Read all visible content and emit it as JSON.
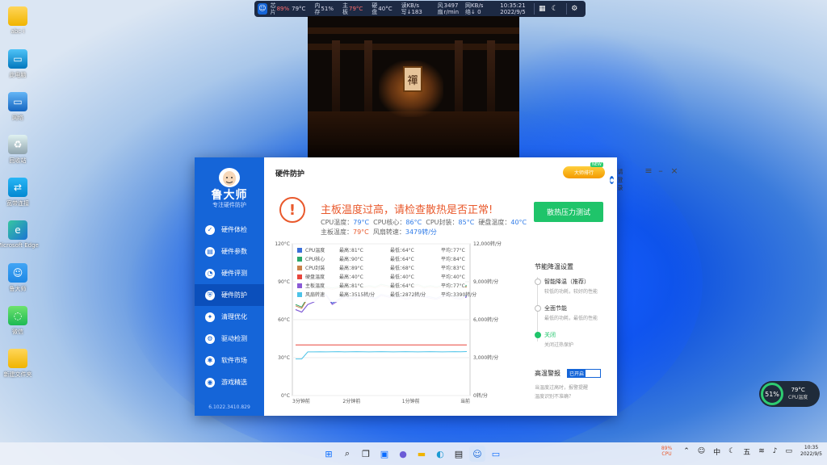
{
  "desktop": {
    "icons": [
      {
        "label": "abc-i",
        "icon": "folder-icon"
      },
      {
        "label": "此电脑",
        "icon": "computer-icon"
      },
      {
        "label": "网络",
        "icon": "network-icon"
      },
      {
        "label": "回收站",
        "icon": "recycle-bin-icon"
      },
      {
        "label": "宽带连接",
        "icon": "broadband-icon"
      },
      {
        "label": "Microsoft Edge",
        "icon": "edge-icon"
      },
      {
        "label": "鲁大师",
        "icon": "ludashi-icon"
      },
      {
        "label": "微信",
        "icon": "wechat-icon"
      },
      {
        "label": "新建文件夹",
        "icon": "folder-icon"
      }
    ]
  },
  "monitor_bar": {
    "cpu_label_1": "芯",
    "cpu_label_2": "片",
    "cpu_usage": "89%",
    "cpu_temp": "79°C",
    "mem_label_1": "内",
    "mem_label_2": "存",
    "mem_usage": "51%",
    "board_label_1": "主",
    "board_label_2": "板",
    "board_temp": "79°C",
    "disk_label_1": "硬",
    "disk_label_2": "盘",
    "disk_temp": "40°C",
    "rw_label_1": "读",
    "rw_label_2": "写",
    "read_speed": "49 KB/s",
    "write_speed": "183 KB/s",
    "fan_label_1": "风",
    "fan_label_2": "扇",
    "fan_speed": "3497",
    "fan_unit": "r/min",
    "net_label_1": "网",
    "net_label_2": "络",
    "net_up": "23 KB/s",
    "net_down": "0 KB/s",
    "time": "10:35:21",
    "date": "2022/9/5"
  },
  "app": {
    "brand": "鲁大师",
    "brand_sub": "专注硬件防护",
    "version": "6.1022.3410.829",
    "nav": [
      {
        "label": "硬件体检",
        "icon": "checkup-icon",
        "active": false
      },
      {
        "label": "硬件参数",
        "icon": "params-icon",
        "active": false
      },
      {
        "label": "硬件评测",
        "icon": "benchmark-icon",
        "active": false
      },
      {
        "label": "硬件防护",
        "icon": "shield-icon",
        "active": true
      },
      {
        "label": "清理优化",
        "icon": "clean-icon",
        "active": false
      },
      {
        "label": "驱动检测",
        "icon": "driver-icon",
        "active": false
      },
      {
        "label": "软件市场",
        "icon": "market-icon",
        "active": false
      },
      {
        "label": "游戏精选",
        "icon": "game-icon",
        "active": false
      }
    ],
    "title": "硬件防护",
    "rank_button": "大师排行",
    "new_tag": "NEW",
    "login": "请登录",
    "warning": "主板温度过高，请检查散热是否正常!",
    "stats": {
      "cpu_temp_label": "CPU温度：",
      "cpu_temp": "79°C",
      "cpu_core_label": "CPU核心：",
      "cpu_core": "86°C",
      "cpu_pkg_label": "CPU封装：",
      "cpu_pkg": "85°C",
      "disk_label": "硬盘温度：",
      "disk": "40°C",
      "board_label": "主板温度：",
      "board": "79°C",
      "fan_label": "风扇转速：",
      "fan": "3479转/分"
    },
    "stress_button": "散热压力测试",
    "cooling": {
      "title": "节能降温设置",
      "options": [
        {
          "label": "智能降温（推荐）",
          "desc": "较低的功耗，较好的性能",
          "selected": false
        },
        {
          "label": "全面节能",
          "desc": "最低的功耗，最低的性能",
          "selected": false
        },
        {
          "label": "关闭",
          "desc": "关闭过热保护",
          "selected": true
        }
      ]
    },
    "alarm": {
      "label": "高温警报",
      "toggle": "已开启",
      "desc_1": "当温度过高时，报警提醒",
      "desc_2": "温度识别不准确？"
    }
  },
  "chart_data": {
    "type": "line",
    "x_ticks": [
      "3分钟前",
      "2分钟前",
      "1分钟前",
      "当前"
    ],
    "y_left_ticks": [
      "0°C",
      "30°C",
      "60°C",
      "90°C",
      "120°C"
    ],
    "y_right_ticks": [
      "0转/分",
      "3,000转/分",
      "6,000转/分",
      "9,000转/分",
      "12,000转/分"
    ],
    "ylim_left": [
      0,
      120
    ],
    "ylim_right": [
      0,
      12000
    ],
    "legend": [
      {
        "name": "CPU温度",
        "max_label": "最高：",
        "max": "81°C",
        "min_label": "最低：",
        "min": "64°C",
        "avg_label": "平均：",
        "avg": "77°C",
        "color": "#3b6fd9"
      },
      {
        "name": "CPU核心",
        "max_label": "最高：",
        "max": "90°C",
        "min_label": "最低：",
        "min": "64°C",
        "avg_label": "平均：",
        "avg": "84°C",
        "color": "#2aa86a"
      },
      {
        "name": "CPU封装",
        "max_label": "最高：",
        "max": "89°C",
        "min_label": "最低：",
        "min": "68°C",
        "avg_label": "平均：",
        "avg": "83°C",
        "color": "#c9814a"
      },
      {
        "name": "硬盘温度",
        "max_label": "最高：",
        "max": "40°C",
        "min_label": "最低：",
        "min": "40°C",
        "avg_label": "平均：",
        "avg": "40°C",
        "color": "#e8453c"
      },
      {
        "name": "主板温度",
        "max_label": "最高：",
        "max": "81°C",
        "min_label": "最低：",
        "min": "64°C",
        "avg_label": "平均：",
        "avg": "77°C",
        "color": "#8a5ad6"
      },
      {
        "name": "风扇转速",
        "max_label": "最高：",
        "max": "3515转/分",
        "min_label": "最低：",
        "min": "2872转/分",
        "avg_label": "平均：",
        "avg": "3390转/分",
        "color": "#4cc3e8"
      }
    ],
    "series": [
      {
        "name": "CPU核心",
        "axis": "left",
        "color": "#2aa86a",
        "values": [
          72,
          70,
          78,
          80,
          84,
          86,
          85,
          86,
          87,
          86,
          88,
          86,
          87,
          86,
          88,
          87,
          86,
          88,
          86,
          87,
          88,
          86,
          87,
          86,
          87,
          88,
          87,
          86,
          87
        ]
      },
      {
        "name": "CPU封装",
        "axis": "left",
        "color": "#c9814a",
        "values": [
          71,
          69,
          77,
          79,
          83,
          85,
          84,
          85,
          86,
          85,
          87,
          85,
          86,
          85,
          87,
          86,
          85,
          87,
          85,
          86,
          87,
          85,
          86,
          85,
          86,
          87,
          86,
          85,
          86
        ]
      },
      {
        "name": "CPU温度",
        "axis": "left",
        "color": "#3b6fd9",
        "values": [
          68,
          66,
          72,
          74,
          78,
          80,
          73,
          76,
          79,
          77,
          78,
          80,
          79,
          77,
          80,
          79,
          78,
          79,
          77,
          78,
          80,
          79,
          78,
          77,
          79,
          80,
          78,
          77,
          79
        ]
      },
      {
        "name": "主板温度",
        "axis": "left",
        "color": "#8a5ad6",
        "values": [
          68,
          66,
          72,
          74,
          78,
          79,
          72,
          75,
          78,
          76,
          77,
          79,
          78,
          76,
          79,
          78,
          77,
          78,
          76,
          77,
          79,
          78,
          77,
          76,
          78,
          79,
          77,
          76,
          78
        ]
      },
      {
        "name": "硬盘温度",
        "axis": "left",
        "color": "#e8453c",
        "values": [
          40,
          40,
          40,
          40,
          40,
          40,
          40,
          40,
          40,
          40,
          40,
          40,
          40,
          40,
          40,
          40,
          40,
          40,
          40,
          40,
          40,
          40,
          40,
          40,
          40,
          40,
          40,
          40,
          40
        ]
      },
      {
        "name": "风扇转速",
        "axis": "right",
        "color": "#4cc3e8",
        "values": [
          2900,
          2900,
          3450,
          3450,
          3460,
          3450,
          3460,
          3470,
          3450,
          3460,
          3470,
          3460,
          3450,
          3460,
          3470,
          3460,
          3450,
          3460,
          3470,
          3460,
          3450,
          3460,
          3470,
          3460,
          3450,
          3460,
          3470,
          3460,
          3479
        ]
      }
    ]
  },
  "widget": {
    "percent": "51%",
    "temp": "79°C",
    "label": "CPU温度"
  },
  "taskbar": {
    "cpu_pct": "89%",
    "cpu_label": "CPU",
    "ime_1": "中",
    "ime_2": "五",
    "time": "10:35",
    "date": "2022/9/5"
  }
}
